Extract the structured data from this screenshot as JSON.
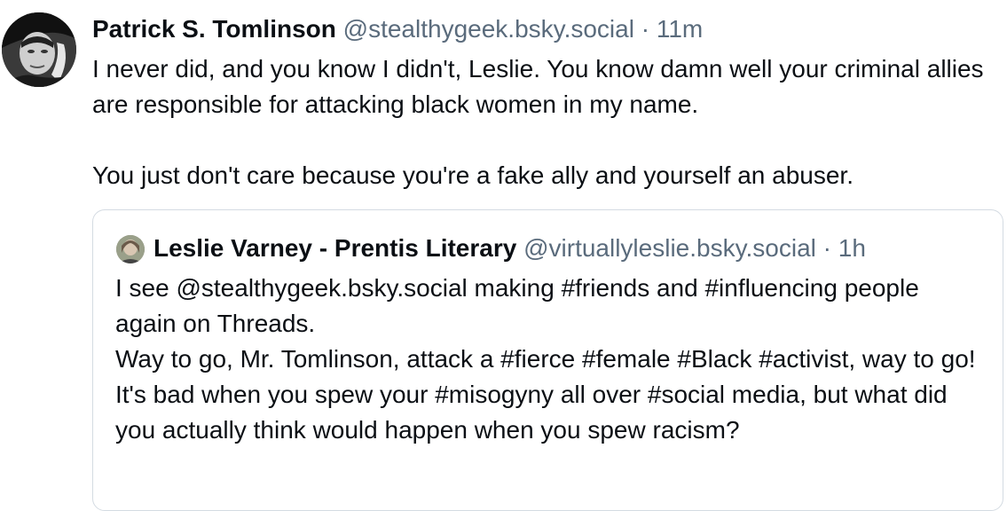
{
  "post": {
    "author_name": "Patrick S. Tomlinson",
    "author_handle": "@stealthygeek.bsky.social",
    "separator": "·",
    "time": "11m",
    "paragraphs": [
      "I never did, and you know I didn't, Leslie. You know damn well your criminal allies are responsible for attacking black women in my name.",
      "You just don't care because you're a fake ally and yourself an abuser."
    ]
  },
  "quoted_post": {
    "author_name": "Leslie Varney - Prentis Literary",
    "author_handle": "@virtuallyleslie.bsky.social",
    "separator": "·",
    "time": "1h",
    "lines": [
      "I see @stealthygeek.bsky.social making #friends and #influencing people again on Threads.",
      "Way to go, Mr. Tomlinson, attack a #fierce #female #Black #activist, way to go!",
      "It's bad when you spew your #misogyny all over #social media, but what did you actually think would happen when you spew racism?"
    ]
  },
  "colors": {
    "text": "#0b0f14",
    "meta": "#5a6b7c",
    "quote_border": "#d4dbe2"
  }
}
